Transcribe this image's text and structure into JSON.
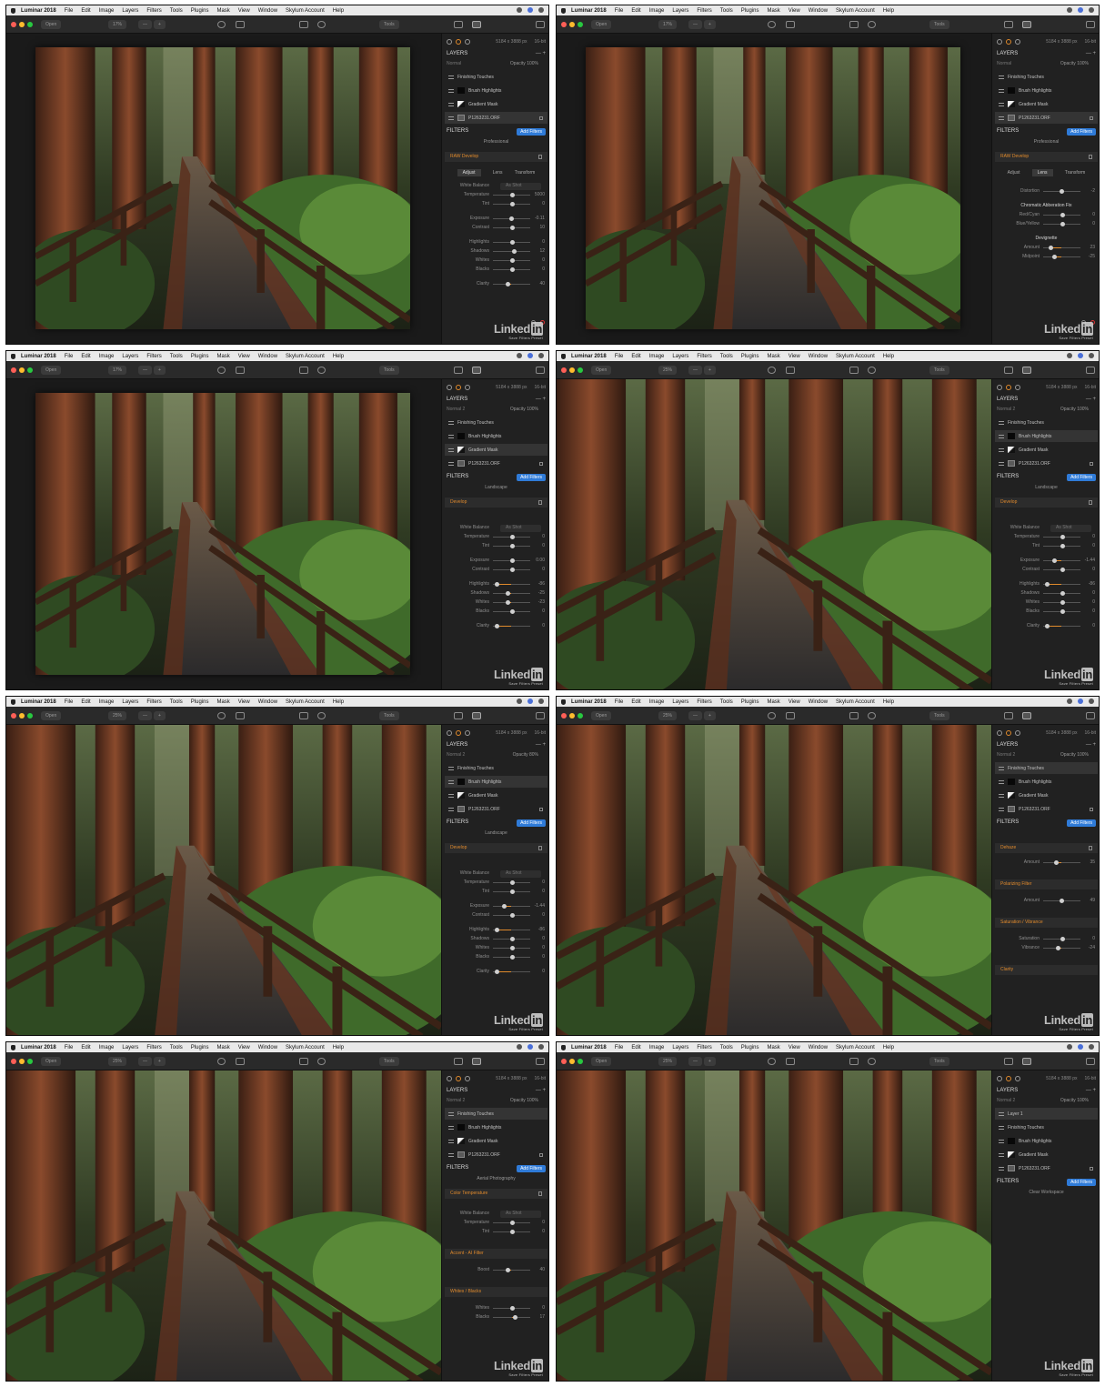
{
  "app": {
    "name": "Luminar 2018",
    "menus": [
      "File",
      "Edit",
      "Image",
      "Layers",
      "Filters",
      "Tools",
      "Plugins",
      "Mask",
      "View",
      "Window",
      "Skylum Account",
      "Help"
    ],
    "image_info": "5184 x 3888 px",
    "bit_depth": "16-bit",
    "open_label": "Open",
    "tools_label": "Tools",
    "watermark": "Linked",
    "watermark_in": "in",
    "watermark_sub": "Save Filters Preset"
  },
  "colors": {
    "accent": "#e08a2c",
    "button_blue": "#2f7bd8",
    "panel_bg": "#212121"
  },
  "frames": [
    {
      "id": "f1",
      "zoom": "17%",
      "photo_size": "small",
      "blend_mode": "Normal",
      "opacity": "Opacity 100%",
      "layers": [
        {
          "name": "Finishing Touches",
          "type": "adjust",
          "selected": false
        },
        {
          "name": "Brush Highlights",
          "type": "black",
          "selected": false
        },
        {
          "name": "Gradient Mask",
          "type": "mask",
          "selected": false
        },
        {
          "name": "P1263231.ORF",
          "type": "image",
          "selected": true
        }
      ],
      "add_filters": "Add Filters",
      "filters_label": "FILTERS",
      "layers_label": "LAYERS",
      "workspace": "Professional",
      "filter_title": "RAW Develop",
      "tabs": [
        "Adjust",
        "Lens",
        "Transform"
      ],
      "active_tab": 0,
      "rows": [
        {
          "kind": "wb",
          "label": "White Balance",
          "value": "As Shot"
        },
        {
          "kind": "slider",
          "label": "Temperature",
          "value": "5000",
          "pos": 0.5
        },
        {
          "kind": "slider",
          "label": "Tint",
          "value": "0",
          "pos": 0.5
        },
        {
          "kind": "gap"
        },
        {
          "kind": "slider",
          "label": "Exposure",
          "value": "-0.11",
          "pos": 0.48
        },
        {
          "kind": "slider",
          "label": "Contrast",
          "value": "10",
          "pos": 0.52
        },
        {
          "kind": "gap"
        },
        {
          "kind": "slider",
          "label": "Highlights",
          "value": "0",
          "pos": 0.5
        },
        {
          "kind": "slider",
          "label": "Shadows",
          "value": "12",
          "pos": 0.55
        },
        {
          "kind": "slider",
          "label": "Whites",
          "value": "0",
          "pos": 0.5
        },
        {
          "kind": "slider",
          "label": "Blacks",
          "value": "0",
          "pos": 0.5
        },
        {
          "kind": "gap"
        },
        {
          "kind": "slider",
          "label": "Clarity",
          "value": "40",
          "pos": 0.4
        }
      ],
      "bottom_icons": true
    },
    {
      "id": "f2",
      "zoom": "17%",
      "photo_size": "small",
      "blend_mode": "Normal",
      "opacity": "Opacity 100%",
      "layers": [
        {
          "name": "Finishing Touches",
          "type": "adjust",
          "selected": false
        },
        {
          "name": "Brush Highlights",
          "type": "black",
          "selected": false
        },
        {
          "name": "Gradient Mask",
          "type": "mask",
          "selected": false
        },
        {
          "name": "P1263231.ORF",
          "type": "image",
          "selected": true
        }
      ],
      "add_filters": "Add Filters",
      "filters_label": "FILTERS",
      "layers_label": "LAYERS",
      "workspace": "Professional",
      "filter_title": "RAW Develop",
      "tabs": [
        "Adjust",
        "Lens",
        "Transform"
      ],
      "active_tab": 1,
      "rows": [
        {
          "kind": "gap"
        },
        {
          "kind": "slider",
          "label": "Distortion",
          "value": "-2",
          "pos": 0.48
        },
        {
          "kind": "gap"
        },
        {
          "kind": "title",
          "label": "Chromatic Abberation Fix"
        },
        {
          "kind": "slider",
          "label": "Red/Cyan",
          "value": "0",
          "pos": 0.5
        },
        {
          "kind": "slider",
          "label": "Blue/Yellow",
          "value": "0",
          "pos": 0.5
        },
        {
          "kind": "gap"
        },
        {
          "kind": "title",
          "label": "Devignette"
        },
        {
          "kind": "slider",
          "label": "Amount",
          "value": "23",
          "pos": 0.2
        },
        {
          "kind": "slider",
          "label": "Midpoint",
          "value": "-25",
          "pos": 0.3
        }
      ],
      "bottom_icons": true
    },
    {
      "id": "f3",
      "zoom": "17%",
      "photo_size": "small",
      "blend_mode": "Normal 2",
      "opacity": "Opacity 100%",
      "layers": [
        {
          "name": "Finishing Touches",
          "type": "adjust",
          "selected": false
        },
        {
          "name": "Brush Highlights",
          "type": "black",
          "selected": false
        },
        {
          "name": "Gradient Mask",
          "type": "mask",
          "selected": true
        },
        {
          "name": "P1263231.ORF",
          "type": "image",
          "selected": false
        }
      ],
      "add_filters": "Add Filters",
      "filters_label": "FILTERS",
      "layers_label": "LAYERS",
      "workspace": "Landscape",
      "filter_title": "Develop",
      "tabs": [],
      "active_tab": -1,
      "rows": [
        {
          "kind": "gap"
        },
        {
          "kind": "gap"
        },
        {
          "kind": "wb",
          "label": "White Balance",
          "value": "As Shot"
        },
        {
          "kind": "slider",
          "label": "Temperature",
          "value": "0",
          "pos": 0.5
        },
        {
          "kind": "slider",
          "label": "Tint",
          "value": "0",
          "pos": 0.5
        },
        {
          "kind": "gap"
        },
        {
          "kind": "slider",
          "label": "Exposure",
          "value": "0.00",
          "pos": 0.5
        },
        {
          "kind": "slider",
          "label": "Contrast",
          "value": "0",
          "pos": 0.5
        },
        {
          "kind": "gap"
        },
        {
          "kind": "slider",
          "label": "Highlights",
          "value": "-86",
          "pos": 0.1
        },
        {
          "kind": "slider",
          "label": "Shadows",
          "value": "-25",
          "pos": 0.38
        },
        {
          "kind": "slider",
          "label": "Whites",
          "value": "-23",
          "pos": 0.39
        },
        {
          "kind": "slider",
          "label": "Blacks",
          "value": "0",
          "pos": 0.5
        },
        {
          "kind": "gap"
        },
        {
          "kind": "slider",
          "label": "Clarity",
          "value": "0",
          "pos": 0.1
        }
      ],
      "bottom_icons": false
    },
    {
      "id": "f4",
      "zoom": "25%",
      "photo_size": "full",
      "blend_mode": "Normal 2",
      "opacity": "Opacity 100%",
      "layers": [
        {
          "name": "Finishing Touches",
          "type": "adjust",
          "selected": false
        },
        {
          "name": "Brush Highlights",
          "type": "black",
          "selected": true
        },
        {
          "name": "Gradient Mask",
          "type": "mask",
          "selected": false
        },
        {
          "name": "P1263231.ORF",
          "type": "image",
          "selected": false
        }
      ],
      "add_filters": "Add Filters",
      "filters_label": "FILTERS",
      "layers_label": "LAYERS",
      "workspace": "Landscape",
      "filter_title": "Develop",
      "tabs": [],
      "active_tab": -1,
      "rows": [
        {
          "kind": "gap"
        },
        {
          "kind": "gap"
        },
        {
          "kind": "wb",
          "label": "White Balance",
          "value": "As Shot"
        },
        {
          "kind": "slider",
          "label": "Temperature",
          "value": "0",
          "pos": 0.5
        },
        {
          "kind": "slider",
          "label": "Tint",
          "value": "0",
          "pos": 0.5
        },
        {
          "kind": "gap"
        },
        {
          "kind": "slider",
          "label": "Exposure",
          "value": "-1.44",
          "pos": 0.3
        },
        {
          "kind": "slider",
          "label": "Contrast",
          "value": "0",
          "pos": 0.5
        },
        {
          "kind": "gap"
        },
        {
          "kind": "slider",
          "label": "Highlights",
          "value": "-86",
          "pos": 0.1
        },
        {
          "kind": "slider",
          "label": "Shadows",
          "value": "0",
          "pos": 0.5
        },
        {
          "kind": "slider",
          "label": "Whites",
          "value": "0",
          "pos": 0.5
        },
        {
          "kind": "slider",
          "label": "Blacks",
          "value": "0",
          "pos": 0.5
        },
        {
          "kind": "gap"
        },
        {
          "kind": "slider",
          "label": "Clarity",
          "value": "0",
          "pos": 0.1
        }
      ],
      "bottom_icons": false
    },
    {
      "id": "f5",
      "zoom": "25%",
      "photo_size": "full",
      "blend_mode": "Normal 2",
      "opacity": "Opacity 80%",
      "layers": [
        {
          "name": "Finishing Touches",
          "type": "adjust",
          "selected": false
        },
        {
          "name": "Brush Highlights",
          "type": "black",
          "selected": true
        },
        {
          "name": "Gradient Mask",
          "type": "mask",
          "selected": false
        },
        {
          "name": "P1263231.ORF",
          "type": "image",
          "selected": false
        }
      ],
      "add_filters": "Add Filters",
      "filters_label": "FILTERS",
      "layers_label": "LAYERS",
      "workspace": "Landscape",
      "filter_title": "Develop",
      "tabs": [],
      "active_tab": -1,
      "rows": [
        {
          "kind": "gap"
        },
        {
          "kind": "gap"
        },
        {
          "kind": "wb",
          "label": "White Balance",
          "value": "As Shot"
        },
        {
          "kind": "slider",
          "label": "Temperature",
          "value": "0",
          "pos": 0.5
        },
        {
          "kind": "slider",
          "label": "Tint",
          "value": "0",
          "pos": 0.5
        },
        {
          "kind": "gap"
        },
        {
          "kind": "slider",
          "label": "Exposure",
          "value": "-1.44",
          "pos": 0.3
        },
        {
          "kind": "slider",
          "label": "Contrast",
          "value": "0",
          "pos": 0.5
        },
        {
          "kind": "gap"
        },
        {
          "kind": "slider",
          "label": "Highlights",
          "value": "-86",
          "pos": 0.1
        },
        {
          "kind": "slider",
          "label": "Shadows",
          "value": "0",
          "pos": 0.5
        },
        {
          "kind": "slider",
          "label": "Whites",
          "value": "0",
          "pos": 0.5
        },
        {
          "kind": "slider",
          "label": "Blacks",
          "value": "0",
          "pos": 0.5
        },
        {
          "kind": "gap"
        },
        {
          "kind": "slider",
          "label": "Clarity",
          "value": "0",
          "pos": 0.1
        }
      ],
      "bottom_icons": false
    },
    {
      "id": "f6",
      "zoom": "25%",
      "photo_size": "full",
      "blend_mode": "Normal 2",
      "opacity": "Opacity 100%",
      "layers": [
        {
          "name": "Finishing Touches",
          "type": "adjust",
          "selected": true
        },
        {
          "name": "Brush Highlights",
          "type": "black",
          "selected": false
        },
        {
          "name": "Gradient Mask",
          "type": "mask",
          "selected": false
        },
        {
          "name": "P1263231.ORF",
          "type": "image",
          "selected": false
        }
      ],
      "add_filters": "Add Filters",
      "filters_label": "FILTERS",
      "layers_label": "LAYERS",
      "workspace": "",
      "filter_title": "Dehaze",
      "tabs": [],
      "active_tab": -1,
      "rows": [
        {
          "kind": "slider",
          "label": "Amount",
          "value": "35",
          "pos": 0.35
        },
        {
          "kind": "gap"
        },
        {
          "kind": "gap"
        },
        {
          "kind": "header",
          "label": "Polarizing Filter"
        },
        {
          "kind": "gap"
        },
        {
          "kind": "slider",
          "label": "Amount",
          "value": "49",
          "pos": 0.49
        },
        {
          "kind": "gap"
        },
        {
          "kind": "gap"
        },
        {
          "kind": "header",
          "label": "Saturation / Vibrance"
        },
        {
          "kind": "gap"
        },
        {
          "kind": "slider",
          "label": "Saturation",
          "value": "0",
          "pos": 0.5
        },
        {
          "kind": "slider",
          "label": "Vibrance",
          "value": "-24",
          "pos": 0.38
        },
        {
          "kind": "gap"
        },
        {
          "kind": "gap"
        },
        {
          "kind": "header",
          "label": "Clarity"
        }
      ],
      "bottom_icons": false
    },
    {
      "id": "f7",
      "zoom": "25%",
      "photo_size": "full",
      "blend_mode": "Normal 2",
      "opacity": "Opacity 100%",
      "layers": [
        {
          "name": "Finishing Touches",
          "type": "adjust",
          "selected": true
        },
        {
          "name": "Brush Highlights",
          "type": "black",
          "selected": false
        },
        {
          "name": "Gradient Mask",
          "type": "mask",
          "selected": false
        },
        {
          "name": "P1263231.ORF",
          "type": "image",
          "selected": false
        }
      ],
      "add_filters": "Add Filters",
      "filters_label": "FILTERS",
      "layers_label": "LAYERS",
      "workspace": "Aerial Photography",
      "filter_title": "Color Temperature",
      "tabs": [],
      "active_tab": -1,
      "rows": [
        {
          "kind": "gap"
        },
        {
          "kind": "wb",
          "label": "White Balance",
          "value": "As Shot"
        },
        {
          "kind": "slider",
          "label": "Temperature",
          "value": "0",
          "pos": 0.5
        },
        {
          "kind": "slider",
          "label": "Tint",
          "value": "0",
          "pos": 0.5
        },
        {
          "kind": "gap"
        },
        {
          "kind": "gap"
        },
        {
          "kind": "header",
          "label": "Accent - AI Filter"
        },
        {
          "kind": "gap"
        },
        {
          "kind": "slider",
          "label": "Boost",
          "value": "40",
          "pos": 0.4
        },
        {
          "kind": "gap"
        },
        {
          "kind": "gap"
        },
        {
          "kind": "header",
          "label": "Whites / Blacks"
        },
        {
          "kind": "gap"
        },
        {
          "kind": "slider",
          "label": "Whites",
          "value": "0",
          "pos": 0.5
        },
        {
          "kind": "slider",
          "label": "Blacks",
          "value": "17",
          "pos": 0.58
        }
      ],
      "bottom_icons": false
    },
    {
      "id": "f8",
      "zoom": "25%",
      "photo_size": "full",
      "blend_mode": "Normal 2",
      "opacity": "Opacity 100%",
      "layers": [
        {
          "name": "Layer 1",
          "type": "adjust",
          "selected": true
        },
        {
          "name": "Finishing Touches",
          "type": "adjust",
          "selected": false
        },
        {
          "name": "Brush Highlights",
          "type": "black",
          "selected": false
        },
        {
          "name": "Gradient Mask",
          "type": "mask",
          "selected": false
        },
        {
          "name": "P1263231.ORF",
          "type": "image",
          "selected": false
        }
      ],
      "add_filters": "Add Filters",
      "filters_label": "FILTERS",
      "layers_label": "LAYERS",
      "workspace": "Clear Workspace",
      "filter_title": "",
      "tabs": [],
      "active_tab": -1,
      "rows": [],
      "bottom_icons": false
    }
  ]
}
